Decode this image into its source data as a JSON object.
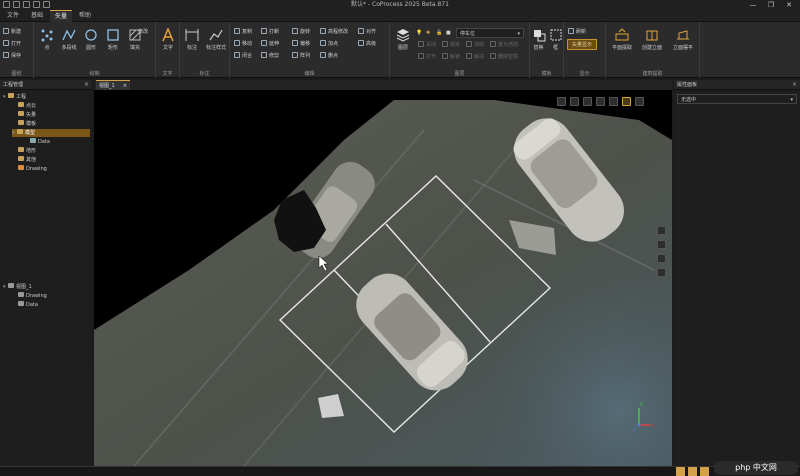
{
  "window": {
    "title": "默认* - CoProcess 2025 Beta.871",
    "controls": [
      "—",
      "❐",
      "✕"
    ]
  },
  "menu_tabs": [
    "文件",
    "基础",
    "矢量",
    "帮助"
  ],
  "active_tab": "矢量",
  "ribbon": {
    "file_group": {
      "label": "图纸",
      "items": [
        "新建",
        "打开",
        "保存"
      ]
    },
    "draw_group": {
      "label": "绘制",
      "items": [
        "点",
        "多段线",
        "圆形",
        "矩形",
        "填充",
        "修改"
      ]
    },
    "text_group": {
      "label": "文字",
      "items": [
        "文字"
      ]
    },
    "dim_group": {
      "label": "标注",
      "items": [
        "标注",
        "标注样式"
      ]
    },
    "edit_group": {
      "label": "编辑",
      "items": [
        "复制",
        "移动",
        "闭合",
        "打断",
        "延伸",
        "修剪",
        "旋转",
        "偏移",
        "阵列",
        "高程修改",
        "加点",
        "删点",
        "对齐",
        "高级"
      ]
    },
    "layer_group": {
      "label": "图层",
      "big": "图层",
      "layer_select": "停车位",
      "tools": [
        "关闭",
        "锁定",
        "冻结",
        "置为当前",
        "打开",
        "解锁",
        "解冻",
        "删除空层"
      ]
    },
    "template_group": {
      "label": "模板",
      "items": [
        "替换",
        "框"
      ]
    },
    "display_group": {
      "label": "显示",
      "items": [
        "刷新",
        "矢量显示"
      ]
    },
    "building_group": {
      "label": "建筑提取",
      "items": [
        "平面提取",
        "创建立面",
        "立面摆平"
      ]
    }
  },
  "left_panel": {
    "title": "工程管理",
    "tree": [
      {
        "label": "工程",
        "level": 0,
        "expanded": true
      },
      {
        "label": "点云",
        "level": 1
      },
      {
        "label": "矢量",
        "level": 1
      },
      {
        "label": "模板",
        "level": 1
      },
      {
        "label": "模型",
        "level": 1,
        "selected": true,
        "expanded": true
      },
      {
        "label": "Data",
        "level": 2
      },
      {
        "label": "地形",
        "level": 1
      },
      {
        "label": "其他",
        "level": 1
      },
      {
        "label": "Drawing",
        "level": 1
      }
    ],
    "tree2": [
      {
        "label": "视图_1",
        "level": 0,
        "expanded": true
      },
      {
        "label": "Drawing",
        "level": 1
      },
      {
        "label": "Data",
        "level": 1
      }
    ]
  },
  "viewport": {
    "tab": "视图_1",
    "axis": {
      "x": "x",
      "y": "y",
      "z": "z"
    },
    "colors": {
      "axis_x": "#e04040",
      "axis_y": "#4ac34a",
      "axis_z": "#4a7ce0",
      "parking_lines": "#e8e8e8",
      "accent": "#d4a24a"
    }
  },
  "right_panel": {
    "title": "属性面板",
    "selection": "无选中"
  },
  "watermark": "php 中文网"
}
